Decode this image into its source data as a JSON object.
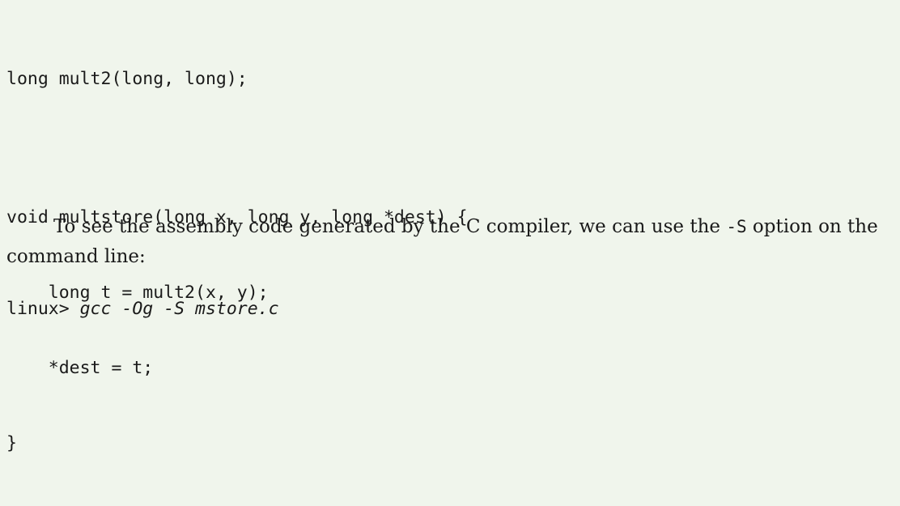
{
  "code": {
    "lines": [
      "long mult2(long, long);",
      "void multstore(long x, long y, long *dest) {",
      "    long t = mult2(x, y);",
      "    *dest = t;",
      "}"
    ]
  },
  "paragraph": {
    "text_before": "To see the assembly code generated by the C compiler, we can use the ",
    "option": "-S",
    "text_after": " option on the command line:"
  },
  "command": {
    "prompt": "linux> ",
    "input": "gcc -Og -S mstore.c"
  }
}
